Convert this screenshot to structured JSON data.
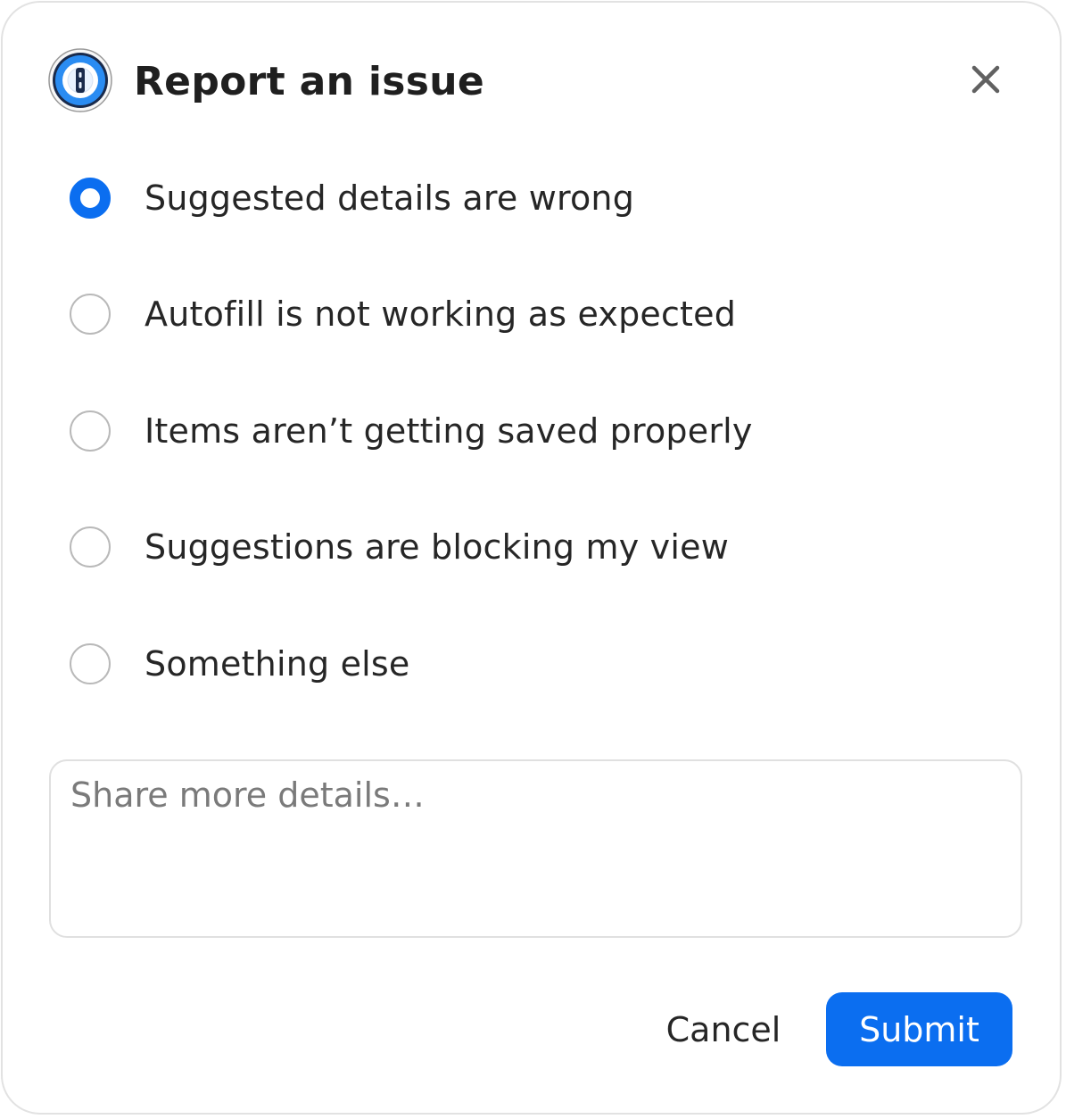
{
  "dialog": {
    "title": "Report an issue",
    "logo_icon": "1password-logo-icon",
    "close_icon": "close-icon"
  },
  "options": [
    {
      "label": "Suggested details are wrong",
      "selected": true
    },
    {
      "label": "Autofill is not working as expected",
      "selected": false
    },
    {
      "label": "Items aren’t getting saved properly",
      "selected": false
    },
    {
      "label": "Suggestions are blocking my view",
      "selected": false
    },
    {
      "label": "Something else",
      "selected": false
    }
  ],
  "details": {
    "placeholder": "Share more details…",
    "value": ""
  },
  "footer": {
    "cancel_label": "Cancel",
    "submit_label": "Submit"
  },
  "colors": {
    "accent": "#0b6ef0",
    "text": "#262626",
    "border": "#e0e0e0"
  }
}
